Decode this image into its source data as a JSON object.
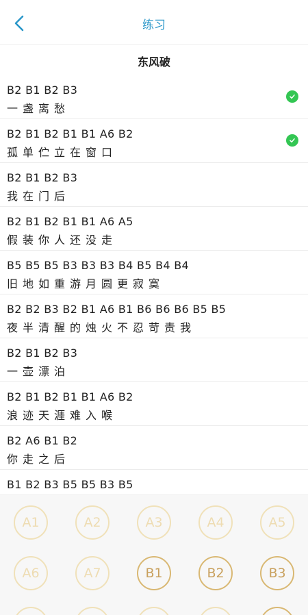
{
  "header": {
    "title": "练习",
    "back_icon": "chevron-left-icon"
  },
  "song": {
    "title": "东风破"
  },
  "rows": [
    {
      "notes": "B2 B1 B2 B3",
      "lyrics": "一盏离愁",
      "done": true
    },
    {
      "notes": "B2 B1 B2 B1 B1 A6 B2",
      "lyrics": "孤单伫立在窗口",
      "done": true
    },
    {
      "notes": "B2 B1 B2 B3",
      "lyrics": "我在门后",
      "done": false
    },
    {
      "notes": "B2 B1 B2 B1 B1 A6 A5",
      "lyrics": "假装你人还没走",
      "done": false
    },
    {
      "notes": "B5 B5 B5 B3 B3 B3 B4 B5 B4 B4",
      "lyrics": "旧地如重游月圆更寂寞",
      "done": false
    },
    {
      "notes": "B2 B2 B3 B2 B1 A6 B1 B6 B6 B6 B5 B5",
      "lyrics": "夜半清醒的烛火不忍苛责我",
      "done": false
    },
    {
      "notes": "B2 B1 B2 B3",
      "lyrics": "一壶漂泊",
      "done": false
    },
    {
      "notes": "B2 B1 B2 B1 B1 A6 B2",
      "lyrics": "浪迹天涯难入喉",
      "done": false
    },
    {
      "notes": "B2 A6 B1 B2",
      "lyrics": "你走之后",
      "done": false
    },
    {
      "notes": "B1 B2 B3 B5 B5 B3 B5",
      "lyrics": "",
      "done": false
    }
  ],
  "keys": [
    {
      "label": "A1",
      "style": "light"
    },
    {
      "label": "A2",
      "style": "light"
    },
    {
      "label": "A3",
      "style": "light"
    },
    {
      "label": "A4",
      "style": "light"
    },
    {
      "label": "A5",
      "style": "light"
    },
    {
      "label": "A6",
      "style": "light"
    },
    {
      "label": "A7",
      "style": "light"
    },
    {
      "label": "B1",
      "style": "dark"
    },
    {
      "label": "B2",
      "style": "dark"
    },
    {
      "label": "B3",
      "style": "dark"
    },
    {
      "label": "",
      "style": "light"
    },
    {
      "label": "",
      "style": "light"
    },
    {
      "label": "",
      "style": "light"
    },
    {
      "label": "",
      "style": "light"
    },
    {
      "label": "",
      "style": "dark"
    }
  ],
  "colors": {
    "accent": "#2a97c9",
    "check": "#33c653",
    "key_light": "#eedcb2",
    "key_dark": "#c9a15e"
  }
}
